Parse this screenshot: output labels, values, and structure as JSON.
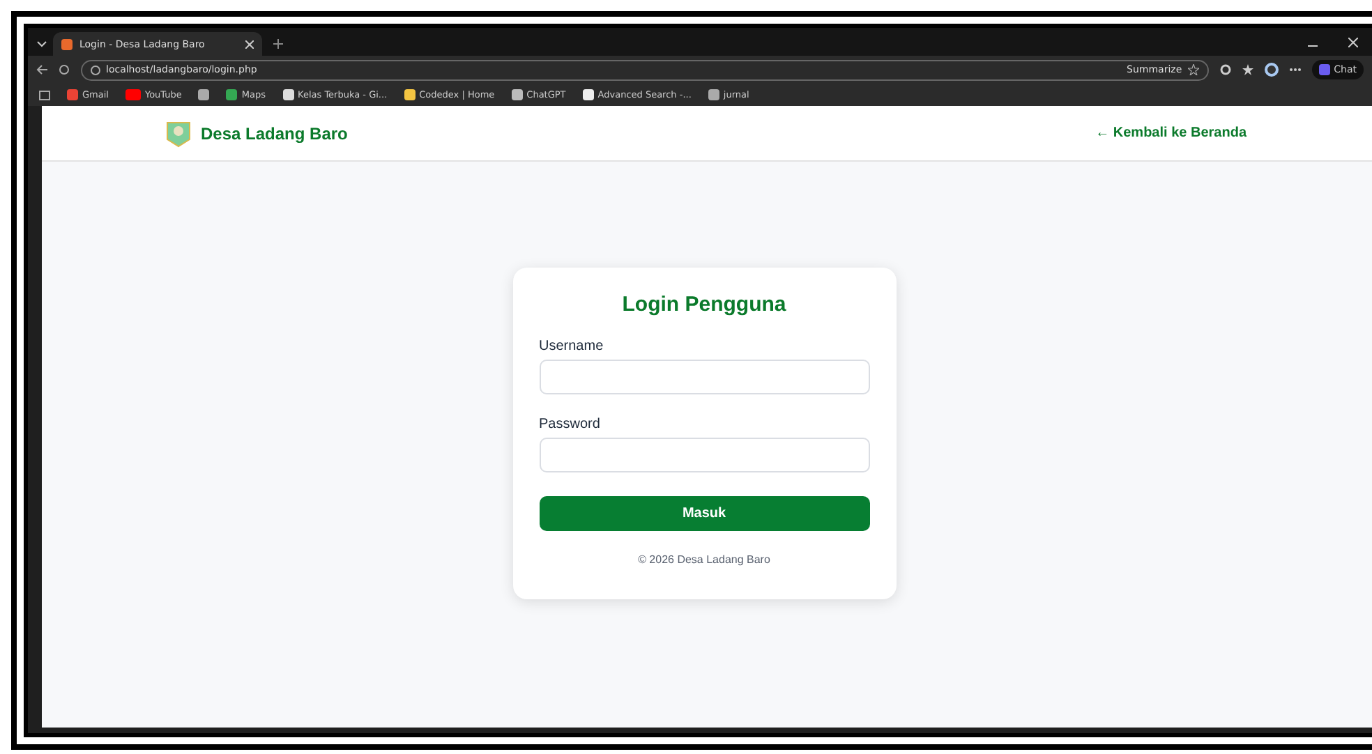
{
  "browser": {
    "tab_title": "Login - Desa Ladang Baro",
    "url": "localhost/ladangbaro/login.php",
    "summarize": "Summarize",
    "chat": "Chat",
    "bookmarks": [
      {
        "label": "Gmail",
        "kind": "gmail"
      },
      {
        "label": "YouTube",
        "kind": "youtube"
      },
      {
        "kind": "apps"
      },
      {
        "label": "Maps",
        "kind": "maps"
      },
      {
        "label": "Kelas Terbuka - Gi...",
        "kind": "github"
      },
      {
        "label": "Codedex | Home",
        "kind": "codedex"
      },
      {
        "label": "ChatGPT",
        "kind": "chatgpt"
      },
      {
        "label": "Advanced Search -...",
        "kind": "m"
      },
      {
        "label": "jurnal",
        "kind": "folder"
      }
    ]
  },
  "header": {
    "brand": "Desa Ladang Baro",
    "back_link": "← Kembali ke Beranda"
  },
  "login": {
    "title": "Login Pengguna",
    "fields": [
      {
        "label": "Username"
      },
      {
        "label": "Password"
      }
    ],
    "submit": "Masuk",
    "footer": "© 2026 Desa Ladang Baro"
  }
}
